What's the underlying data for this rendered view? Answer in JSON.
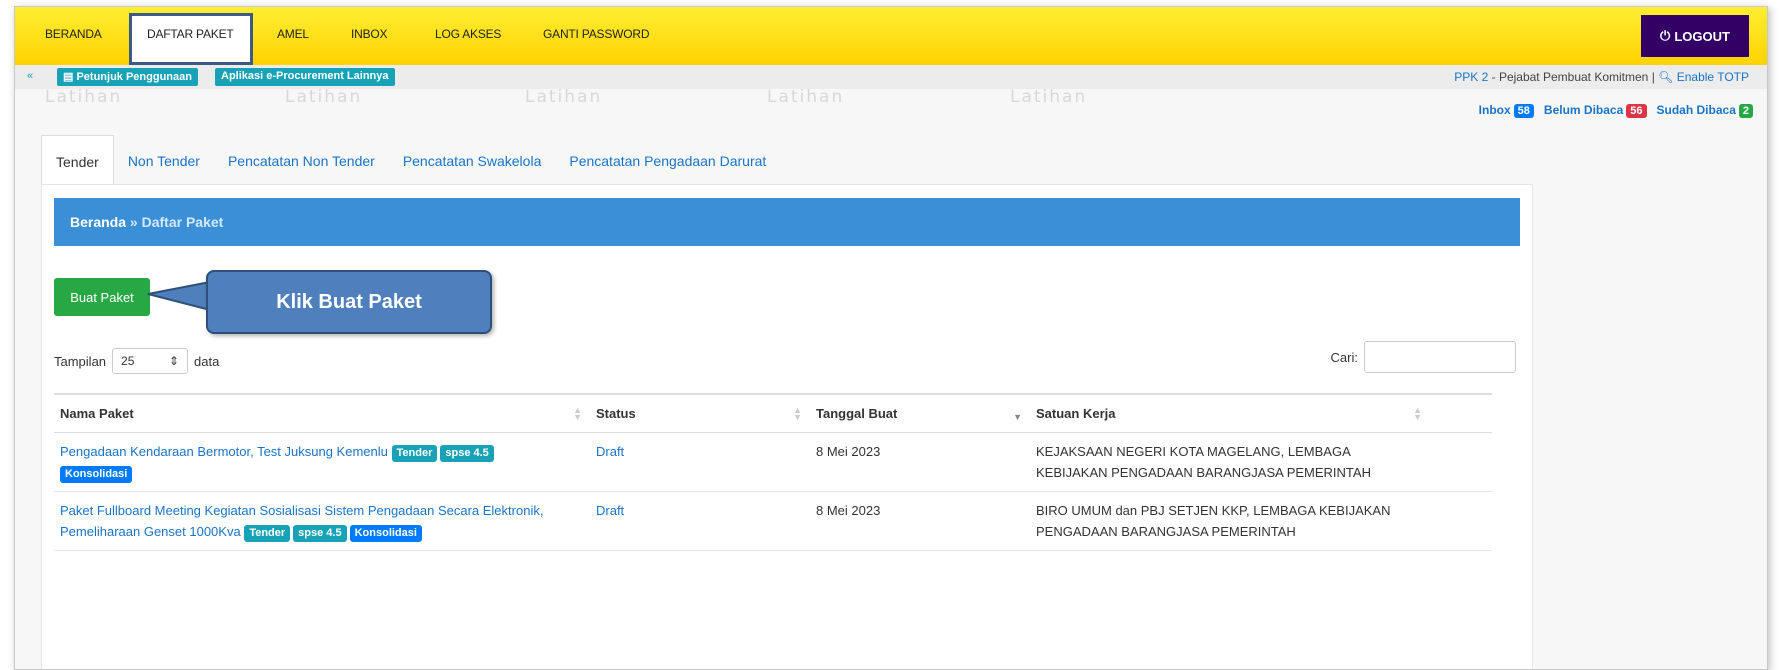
{
  "nav": {
    "items": [
      "BERANDA",
      "DAFTAR PAKET",
      "AMEL",
      "INBOX",
      "LOG AKSES",
      "GANTI PASSWORD"
    ],
    "logout": "LOGOUT"
  },
  "subbar": {
    "petunjuk": "Petunjuk Penggunaan",
    "aplikasi": "Aplikasi e-Procurement Lainnya",
    "user_role": "PPK 2",
    "user_desc": " - Pejabat Pembuat Komitmen | ",
    "totp": "Enable TOTP"
  },
  "watermark": "Latihan",
  "inbox": {
    "inbox_label": "Inbox",
    "inbox_count": "58",
    "belum_label": "Belum Dibaca",
    "belum_count": "56",
    "sudah_label": "Sudah Dibaca",
    "sudah_count": "2"
  },
  "tabs": [
    "Tender",
    "Non Tender",
    "Pencatatan Non Tender",
    "Pencatatan Swakelola",
    "Pencatatan Pengadaan Darurat"
  ],
  "breadcrumb": {
    "home": "Beranda",
    "sep": " » ",
    "current": "Daftar Paket"
  },
  "buat_paket": "Buat Paket",
  "callout": "Klik Buat Paket",
  "length": {
    "before": "Tampilan",
    "value": "25",
    "after": "data"
  },
  "search_label": "Cari:",
  "table": {
    "headers": [
      "Nama Paket",
      "Status",
      "Tanggal Buat",
      "Satuan Kerja"
    ],
    "rows": [
      {
        "nama": "Pengadaan Kendaraan Bermotor, Test Juksung Kemenlu",
        "badges": [
          "Tender",
          "spse 4.5",
          "Konsolidasi"
        ],
        "status": "Draft",
        "tanggal": "8 Mei 2023",
        "satker": "KEJAKSAAN NEGERI KOTA MAGELANG, LEMBAGA KEBIJAKAN PENGADAAN BARANGJASA PEMERINTAH"
      },
      {
        "nama": "Paket Fullboard Meeting Kegiatan Sosialisasi Sistem Pengadaan Secara Elektronik, Pemeliharaan Genset 1000Kva",
        "badges": [
          "Tender",
          "spse 4.5",
          "Konsolidasi"
        ],
        "status": "Draft",
        "tanggal": "8 Mei 2023",
        "satker": "BIRO UMUM dan PBJ SETJEN KKP, LEMBAGA KEBIJAKAN PENGADAAN BARANGJASA PEMERINTAH"
      }
    ]
  },
  "colors": {
    "nav_yellow": "#ffdd00",
    "logout_purple": "#330066",
    "teal": "#17a2b8",
    "blue": "#3a8fd6",
    "green": "#28a745",
    "red": "#dc3545",
    "konsolidasi": "#007bff"
  }
}
